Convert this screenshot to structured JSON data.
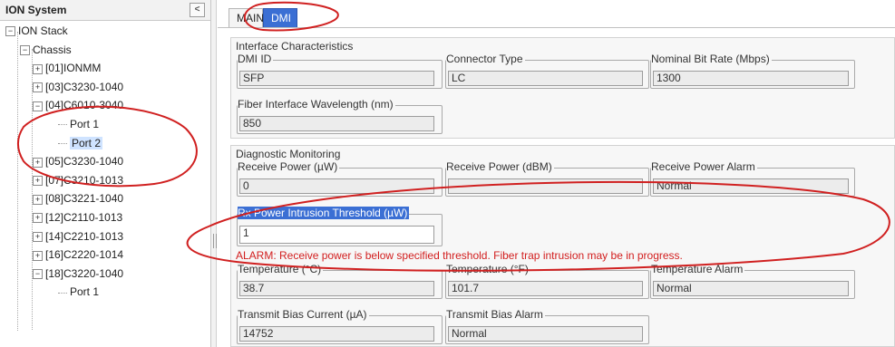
{
  "left_panel": {
    "title": "ION System",
    "collapse_glyph": "<",
    "tree": [
      {
        "label": "ION Stack",
        "expander": "−"
      },
      {
        "label": "Chassis",
        "expander": "−"
      },
      {
        "label": "[01]IONMM",
        "expander": "+"
      },
      {
        "label": "[03]C3230-1040",
        "expander": "+"
      },
      {
        "label": "[04]C6010-3040",
        "expander": "−"
      },
      {
        "label": "Port 1",
        "expander": ""
      },
      {
        "label": "Port 2",
        "expander": "",
        "selected": true
      },
      {
        "label": "[05]C3230-1040",
        "expander": "+"
      },
      {
        "label": "[07]C3210-1013",
        "expander": "+"
      },
      {
        "label": "[08]C3221-1040",
        "expander": "+"
      },
      {
        "label": "[12]C2110-1013",
        "expander": "+"
      },
      {
        "label": "[14]C2210-1013",
        "expander": "+"
      },
      {
        "label": "[16]C2220-1014",
        "expander": "+"
      },
      {
        "label": "[18]C3220-1040",
        "expander": "−"
      },
      {
        "label": "Port 1",
        "expander": ""
      }
    ]
  },
  "tabs": [
    {
      "label": "MAIN",
      "active": false
    },
    {
      "label": "DMI",
      "active": true
    }
  ],
  "interface": {
    "title": "Interface Characteristics",
    "dmi_id": {
      "label": "DMI ID",
      "value": "SFP"
    },
    "connector_type": {
      "label": "Connector Type",
      "value": "LC"
    },
    "nominal_bit_rate": {
      "label": "Nominal Bit Rate (Mbps)",
      "value": "1300"
    },
    "wavelength": {
      "label": "Fiber Interface Wavelength (nm)",
      "value": "850"
    }
  },
  "diagnostic": {
    "title": "Diagnostic Monitoring",
    "rx_power_uw": {
      "label": "Receive Power (µW)",
      "value": "0"
    },
    "rx_power_dbm": {
      "label": "Receive Power (dBM)",
      "value": ""
    },
    "rx_power_alarm": {
      "label": "Receive Power Alarm",
      "value": "Normal"
    },
    "rx_threshold": {
      "label": "Rx Power Intrusion Threshold (µW)",
      "value": "1"
    },
    "alarm_message": "ALARM: Receive power is below specified threshold. Fiber trap intrusion may be in progress.",
    "temp_c": {
      "label": "Temperature (°C)",
      "value": "38.7"
    },
    "temp_f": {
      "label": "Temperature (°F)",
      "value": "101.7"
    },
    "temp_alarm": {
      "label": "Temperature Alarm",
      "value": "Normal"
    },
    "bias_current": {
      "label": "Transmit Bias Current (µA)",
      "value": "14752"
    },
    "bias_alarm": {
      "label": "Transmit Bias Alarm",
      "value": "Normal"
    }
  },
  "colors": {
    "active_tab": "#3b6fd4",
    "alarm_text": "#d21e1e",
    "annotation": "#d02020"
  }
}
